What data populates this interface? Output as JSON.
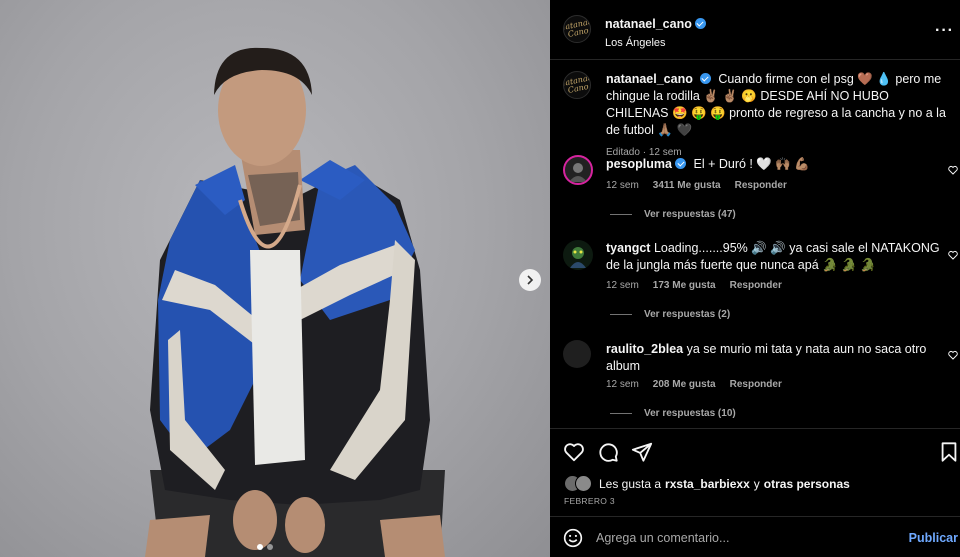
{
  "post": {
    "username": "natanael_cano",
    "location": "Los Ángeles",
    "avatar_text": "Natanael Cano",
    "caption": "Cuando firme con el psg 🤎 💧 pero me chingue la rodilla ✌🏽 ✌🏽 🫢 DESDE AHÍ NO HUBO CHILENAS 🤩 🤑 🤑 pronto de regreso a la cancha y no a la de futbol 🙏🏽 🖤",
    "edited_label": "Editado",
    "edited_time": "12 sem"
  },
  "comments": [
    {
      "username": "pesopluma",
      "verified": true,
      "text": "El + Duró ! 🤍 🙌🏽 💪🏽",
      "time": "12 sem",
      "likes": "3411 Me gusta",
      "reply_label": "Responder",
      "view_replies": "Ver respuestas (47)"
    },
    {
      "username": "tyangct",
      "verified": false,
      "text": "Loading.......95% 🔊 🔊 ya casi sale el NATAKONG de la jungla más fuerte que nunca apá 🐊 🐊 🐊",
      "time": "12 sem",
      "likes": "173 Me gusta",
      "reply_label": "Responder",
      "view_replies": "Ver respuestas (2)"
    },
    {
      "username": "raulito_2blea",
      "verified": false,
      "text": "ya se murio mi tata y nata aun no saca otro album",
      "time": "12 sem",
      "likes": "208 Me gusta",
      "reply_label": "Responder",
      "view_replies": "Ver respuestas (10)"
    }
  ],
  "likes_summary": {
    "prefix": "Les gusta a",
    "user": "rxsta_barbiexx",
    "connector": "y",
    "suffix": "otras personas"
  },
  "post_date": "FEBRERO 3",
  "add_comment": {
    "placeholder": "Agrega un comentario...",
    "publish_label": "Publicar"
  },
  "icons": {
    "like": "heart-icon",
    "comment": "comment-icon",
    "share": "share-icon",
    "save": "bookmark-icon",
    "emoji": "emoji-icon",
    "more": "more-icon",
    "next": "chevron-right-icon"
  },
  "colors": {
    "background": "#000000",
    "link_blue": "#6fa9ff",
    "verified_blue": "#3897f0",
    "muted_text": "#a8a8a8"
  },
  "carousel": {
    "slides": 2,
    "active": 1
  }
}
